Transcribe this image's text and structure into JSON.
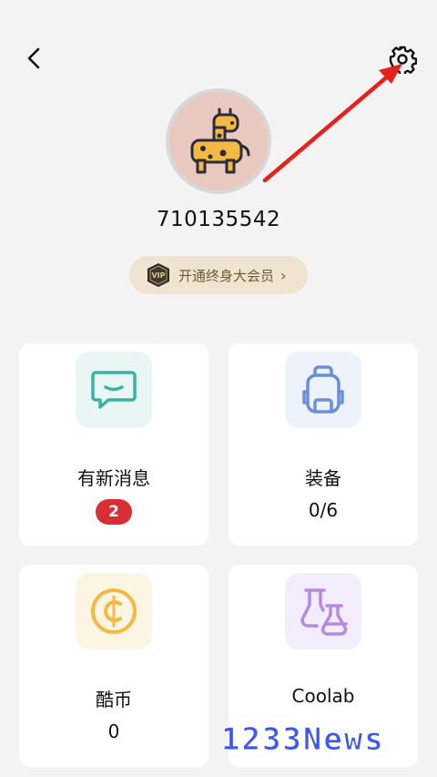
{
  "header": {
    "back_icon": "chevron-left-icon",
    "settings_icon": "gear-icon"
  },
  "profile": {
    "avatar_icon": "giraffe-avatar-icon",
    "username": "710135542",
    "vip": {
      "badge_icon": "vip-badge-icon",
      "label": "开通终身大会员",
      "chevron": "›"
    }
  },
  "cards": [
    {
      "icon": "message-icon",
      "title": "有新消息",
      "badge": "2"
    },
    {
      "icon": "backpack-icon",
      "title": "装备",
      "value": "0/6"
    },
    {
      "icon": "coin-icon",
      "title": "酷币",
      "value": "0"
    },
    {
      "icon": "flask-icon",
      "title": "Coolab",
      "value": ""
    }
  ],
  "watermark": "1233News",
  "colors": {
    "accent_red": "#d72f33",
    "vip_bg": "#efe4cf",
    "arrow": "#e8201b"
  }
}
